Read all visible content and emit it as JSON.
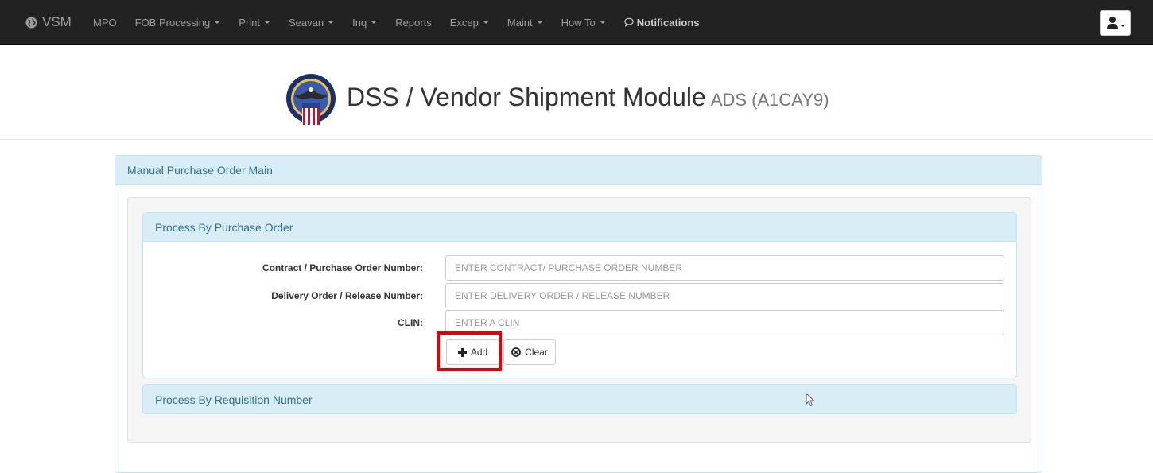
{
  "navbar": {
    "brand": "VSM",
    "items": [
      {
        "label": "MPO",
        "dropdown": false
      },
      {
        "label": "FOB Processing",
        "dropdown": true
      },
      {
        "label": "Print",
        "dropdown": true
      },
      {
        "label": "Seavan",
        "dropdown": true
      },
      {
        "label": "Inq",
        "dropdown": true
      },
      {
        "label": "Reports",
        "dropdown": false
      },
      {
        "label": "Excep",
        "dropdown": true
      },
      {
        "label": "Maint",
        "dropdown": true
      },
      {
        "label": "How To",
        "dropdown": true
      }
    ],
    "notifications_label": "Notifications",
    "user_icon": "user-icon"
  },
  "header": {
    "title": "DSS / Vendor Shipment Module",
    "subtitle": "ADS (A1CAY9)"
  },
  "main_panel": {
    "title": "Manual Purchase Order Main",
    "process_by_po": {
      "title": "Process By Purchase Order",
      "fields": [
        {
          "label": "Contract / Purchase Order Number:",
          "placeholder": "ENTER CONTRACT/ PURCHASE ORDER NUMBER",
          "value": ""
        },
        {
          "label": "Delivery Order / Release Number:",
          "placeholder": "ENTER DELIVERY ORDER / RELEASE NUMBER",
          "value": ""
        },
        {
          "label": "CLIN:",
          "placeholder": "ENTER A CLIN",
          "value": ""
        }
      ],
      "add_label": "Add",
      "clear_label": "Clear"
    },
    "process_by_req": {
      "title": "Process By Requisition Number"
    }
  },
  "colors": {
    "navbar_bg": "#222222",
    "panel_info_bg": "#d9edf7",
    "panel_info_text": "#31708f",
    "highlight": "#e60000"
  }
}
